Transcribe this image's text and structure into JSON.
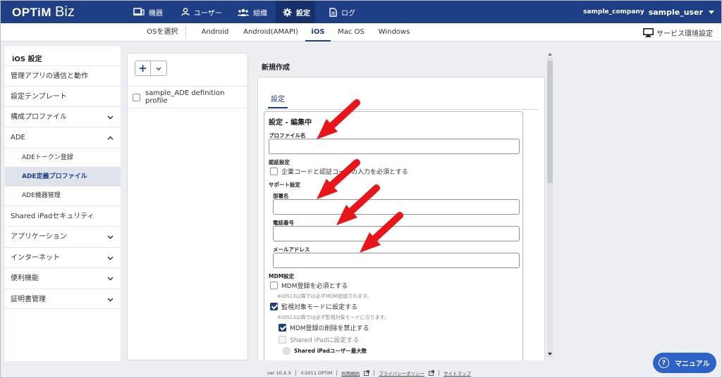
{
  "brand": {
    "logo_main": "OPTiM",
    "logo_sub": "Biz"
  },
  "topnav": {
    "items": [
      {
        "label": "機器",
        "icon": "device-icon"
      },
      {
        "label": "ユーザー",
        "icon": "user-icon"
      },
      {
        "label": "組織",
        "icon": "organization-icon"
      },
      {
        "label": "設定",
        "icon": "gear-icon",
        "active": true
      },
      {
        "label": "ログ",
        "icon": "log-icon"
      }
    ],
    "company": "sample_company",
    "user": "sample_user"
  },
  "subnav": {
    "os_select_label": "OSを選択",
    "tabs": [
      {
        "label": "Android"
      },
      {
        "label": "Android(AMAPI)"
      },
      {
        "label": "iOS",
        "active": true
      },
      {
        "label": "Mac OS"
      },
      {
        "label": "Windows"
      }
    ],
    "service_settings_label": "サービス環境設定"
  },
  "sidebar": {
    "title": "iOS 設定",
    "items": [
      {
        "label": "管理アプリの通信と動作"
      },
      {
        "label": "設定テンプレート"
      },
      {
        "label": "構成プロファイル",
        "chevron": "down"
      },
      {
        "label": "ADE",
        "chevron": "up"
      },
      {
        "label": "ADEトークン登録",
        "sub": true
      },
      {
        "label": "ADE定義プロファイル",
        "sub": true,
        "selected": true
      },
      {
        "label": "ADE機器管理",
        "sub": true
      },
      {
        "label": "Shared iPadセキュリティ"
      },
      {
        "label": "アプリケーション",
        "chevron": "down"
      },
      {
        "label": "インターネット",
        "chevron": "down"
      },
      {
        "label": "便利機能",
        "chevron": "down"
      },
      {
        "label": "証明書管理",
        "chevron": "down"
      }
    ]
  },
  "list": {
    "add_button": "+",
    "rows": [
      {
        "label": "sample_ADE definition profile",
        "checked": false
      }
    ]
  },
  "detail": {
    "title": "新規作成",
    "tab_label": "設定",
    "form_title": "設定 - 編集中",
    "profile_name_label": "プロファイル名",
    "profile_name_value": "",
    "auth_section_label": "認証設定",
    "auth_checkbox_label": "企業コードと認証コードの入力を必須とする",
    "support_section_label": "サポート設定",
    "department_label": "部署名",
    "department_value": "",
    "phone_label": "電話番号",
    "phone_value": "",
    "email_label": "メールアドレス",
    "email_value": "",
    "mdm_section_label": "MDM設定",
    "mdm_required_label": "MDM登録を必須とする",
    "mdm_required_note": "※iOS13以降では必ずMDM登録されます。",
    "supervised_label": "監視対象モードに設定する",
    "supervised_note": "※iOS13以降では必ず監視対象モードになります。",
    "prevent_mdm_removal_label": "MDM登録の削除を禁止する",
    "shared_ipad_label": "Shared iPadに設定する",
    "shared_ipad_max_users_label": "Shared iPadユーザー最大数"
  },
  "footer": {
    "version": "ver 10.X.X",
    "copyright": "©2011 OPTiM",
    "terms": "利用規約",
    "privacy": "プライバシーポリシー",
    "sitemap": "サイトマップ"
  },
  "manual_button": "マニュアル",
  "colors": {
    "nav_bg": "#1e3e85",
    "accent": "#1e3e85",
    "manual_btn": "#2d63c7",
    "annotation_arrow": "#e8151b"
  }
}
